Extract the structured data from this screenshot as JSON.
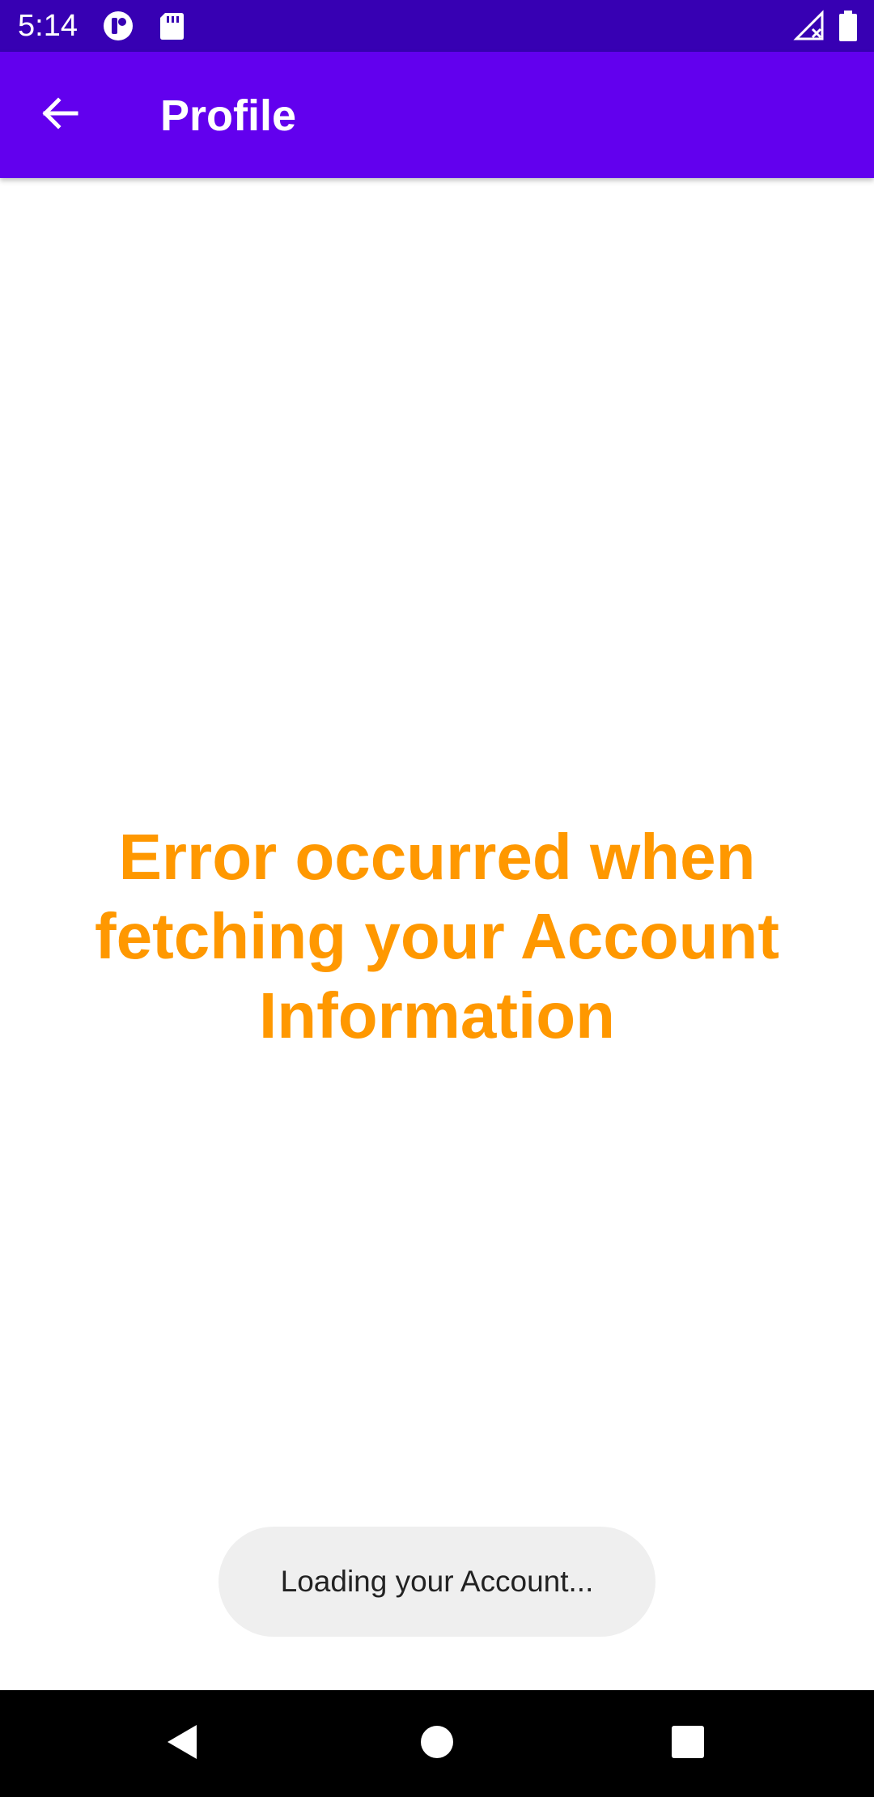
{
  "status_bar": {
    "time": "5:14",
    "icons": [
      "app-notification-icon",
      "sd-card-icon",
      "no-signal-icon",
      "battery-full-icon"
    ]
  },
  "app_bar": {
    "title": "Profile",
    "back_icon": "arrow-back-icon"
  },
  "content": {
    "error_message": "Error occurred when fetching your Account Information"
  },
  "toast": {
    "text": "Loading your Account..."
  },
  "nav_bar": {
    "icons": [
      "back-triangle-icon",
      "home-circle-icon",
      "recents-square-icon"
    ]
  },
  "colors": {
    "status_bar": "#3700b3",
    "app_bar": "#6200ee",
    "error_text": "#ff9800",
    "toast_bg": "#efefef"
  }
}
